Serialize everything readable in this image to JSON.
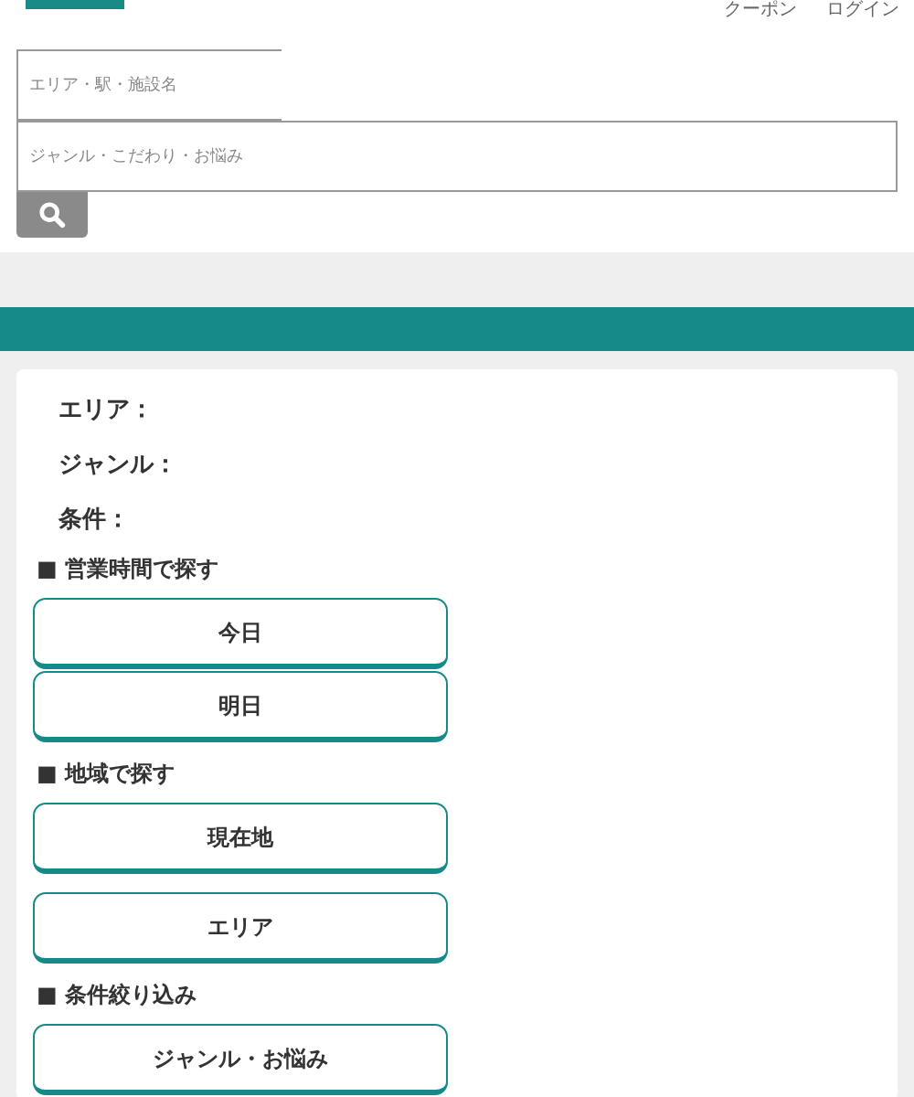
{
  "header": {
    "links": [
      "クーポン",
      "ログイン"
    ]
  },
  "search": {
    "area": {
      "placeholder": "エリア・駅・施設名"
    },
    "genre": {
      "placeholder": "ジャンル・こだわり・お悩み"
    }
  },
  "conditions": [
    {
      "label": "エリア："
    },
    {
      "label": "ジャンル："
    },
    {
      "label": "条件："
    }
  ],
  "sections": [
    {
      "title": "■ 営業時間で探す",
      "buttons": [
        "今日",
        "明日"
      ]
    },
    {
      "title": "■ 地域で探す",
      "buttons": [
        "現在地",
        "エリア"
      ]
    },
    {
      "title": "■ 条件絞り込み",
      "buttons": [
        "ジャンル・お悩み"
      ]
    }
  ]
}
